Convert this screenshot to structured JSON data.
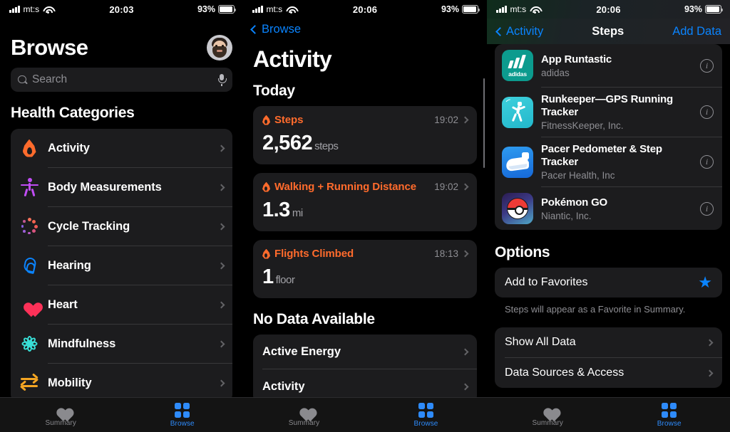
{
  "panel1": {
    "status": {
      "carrier": "mt:s",
      "time": "20:03",
      "battery": "93%"
    },
    "title": "Browse",
    "search": {
      "placeholder": "Search"
    },
    "section_header": "Health Categories",
    "categories": [
      {
        "label": "Activity",
        "icon": "flame-icon"
      },
      {
        "label": "Body Measurements",
        "icon": "body-icon"
      },
      {
        "label": "Cycle Tracking",
        "icon": "cycle-icon"
      },
      {
        "label": "Hearing",
        "icon": "ear-icon"
      },
      {
        "label": "Heart",
        "icon": "heart-icon"
      },
      {
        "label": "Mindfulness",
        "icon": "mindfulness-icon"
      },
      {
        "label": "Mobility",
        "icon": "mobility-icon"
      }
    ],
    "tabs": [
      {
        "label": "Summary",
        "icon": "heart-icon",
        "active": false
      },
      {
        "label": "Browse",
        "icon": "grid-icon",
        "active": true
      }
    ]
  },
  "panel2": {
    "status": {
      "carrier": "mt:s",
      "time": "20:06",
      "battery": "93%"
    },
    "back_label": "Browse",
    "title": "Activity",
    "today_header": "Today",
    "data_cards": [
      {
        "name": "Steps",
        "time": "19:02",
        "value": "2,562",
        "unit": "steps"
      },
      {
        "name": "Walking + Running Distance",
        "time": "19:02",
        "value": "1.3",
        "unit": "mi"
      },
      {
        "name": "Flights Climbed",
        "time": "18:13",
        "value": "1",
        "unit": "floor"
      }
    ],
    "no_data_header": "No Data Available",
    "no_data_rows": [
      {
        "label": "Active Energy"
      },
      {
        "label": "Activity"
      }
    ],
    "tabs": [
      {
        "label": "Summary",
        "icon": "heart-icon",
        "active": false
      },
      {
        "label": "Browse",
        "icon": "grid-icon",
        "active": true
      }
    ]
  },
  "panel3": {
    "status": {
      "carrier": "mt:s",
      "time": "20:06",
      "battery": "93%"
    },
    "back_label": "Activity",
    "title": "Steps",
    "action_label": "Add Data",
    "apps": [
      {
        "name": "App Runtastic",
        "developer": "adidas",
        "icon": "adidas-app-icon"
      },
      {
        "name": "Runkeeper—GPS Running Tracker",
        "developer": "FitnessKeeper, Inc.",
        "icon": "runkeeper-app-icon"
      },
      {
        "name": "Pacer Pedometer & Step Tracker",
        "developer": "Pacer Health, Inc",
        "icon": "pacer-app-icon"
      },
      {
        "name": "Pokémon GO",
        "developer": "Niantic, Inc.",
        "icon": "pokemon-go-app-icon"
      }
    ],
    "options_header": "Options",
    "favorite": {
      "label": "Add to Favorites",
      "icon": "star-icon",
      "note": "Steps will appear as a Favorite in Summary."
    },
    "option_rows": [
      {
        "label": "Show All Data"
      },
      {
        "label": "Data Sources & Access"
      }
    ],
    "tabs": [
      {
        "label": "Summary",
        "icon": "heart-icon",
        "active": false
      },
      {
        "label": "Browse",
        "icon": "grid-icon",
        "active": true
      }
    ]
  },
  "colors": {
    "accent_blue": "#0A84FF",
    "activity_orange": "#FF6B2C",
    "card_bg": "#1C1C1E",
    "screen_bg": "#000000"
  }
}
